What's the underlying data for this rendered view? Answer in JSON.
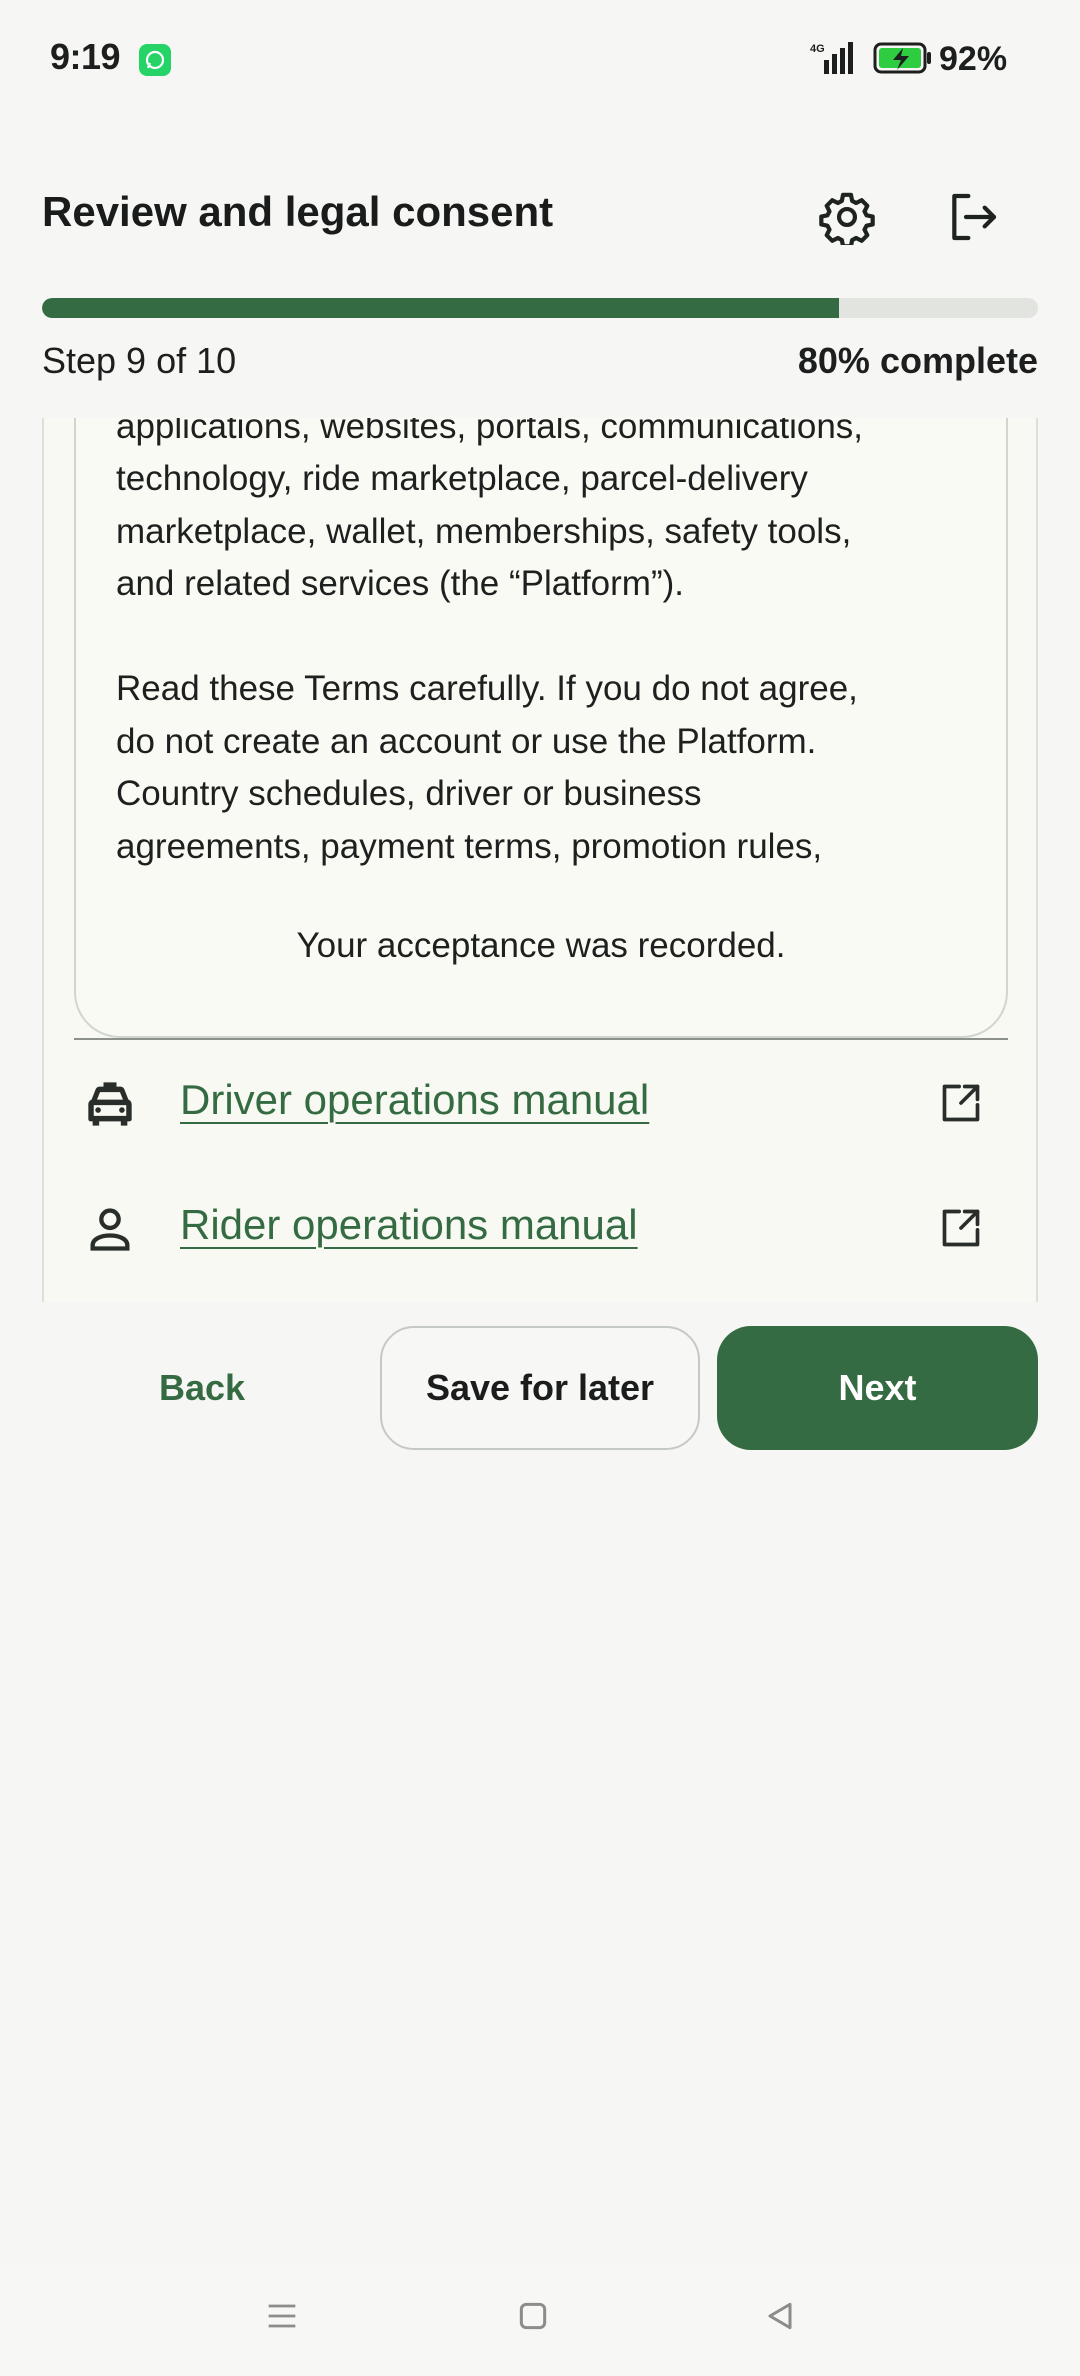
{
  "status_bar": {
    "time": "9:19",
    "network": "4G",
    "battery": "92%",
    "icons": [
      "whatsapp-icon",
      "signal-icon",
      "battery-charging-icon"
    ]
  },
  "header": {
    "title": "Review and legal consent",
    "settings_icon": "gear-icon",
    "exit_icon": "logout-icon"
  },
  "progress": {
    "fraction": 0.8,
    "step_text": "Step 9 of 10",
    "percent_text": "80% complete"
  },
  "terms": {
    "paragraph1": [
      "applications, websites, portals, communications,",
      "technology, ride marketplace, parcel-delivery",
      "marketplace, wallet, memberships, safety tools,",
      "and related services (the “Platform”)."
    ],
    "paragraph2": [
      "Read these Terms carefully. If you do not agree,",
      "do not create an account or use the Platform.",
      "Country schedules, driver or business",
      "agreements, payment terms, promotion rules,"
    ],
    "acceptance_note": "Your acceptance was recorded."
  },
  "manuals": [
    {
      "label": "Driver operations manual",
      "icon": "taxi-icon",
      "action_icon": "open-external-icon"
    },
    {
      "label": "Rider operations manual",
      "icon": "person-icon",
      "action_icon": "open-external-icon"
    }
  ],
  "actions": {
    "back": "Back",
    "save": "Save for later",
    "next": "Next"
  },
  "colors": {
    "accent": "#356b42",
    "background": "#f6f7f5",
    "track": "#e1e4df"
  }
}
